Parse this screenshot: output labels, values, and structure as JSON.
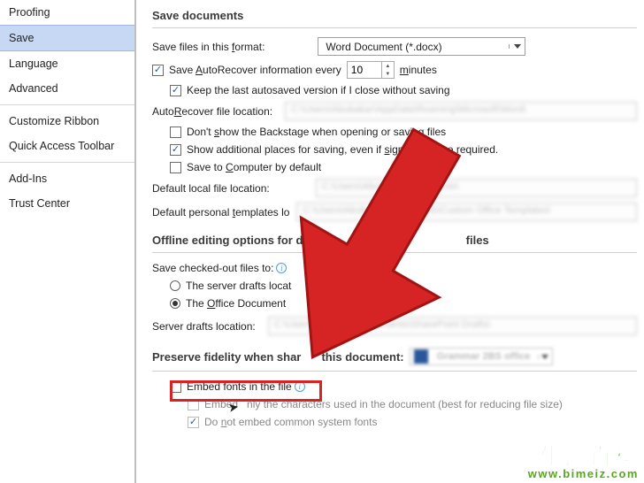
{
  "nav": {
    "items": [
      {
        "label": "Proofing"
      },
      {
        "label": "Save"
      },
      {
        "label": "Language"
      },
      {
        "label": "Advanced"
      },
      {
        "label": "Customize Ribbon"
      },
      {
        "label": "Quick Access Toolbar"
      },
      {
        "label": "Add-Ins"
      },
      {
        "label": "Trust Center"
      }
    ],
    "selected_index": 1
  },
  "save_documents": {
    "title": "Save documents",
    "format_label_pre": "Save files in this ",
    "format_label_u": "f",
    "format_label_post": "ormat:",
    "format_value": "Word Document (*.docx)",
    "autorecover_pre": "Save ",
    "autorecover_u": "A",
    "autorecover_post": "utoRecover information every",
    "autorecover_value": "10",
    "autorecover_unit_u": "m",
    "autorecover_unit_post": "inutes",
    "keep_last_pre": "Keep the last autosaved version if I close without saving",
    "ar_location_pre": "Auto",
    "ar_location_u": "R",
    "ar_location_post": "ecover file location:",
    "ar_location_value": "C:\\Users\\Abubakar\\AppData\\Roaming\\Microsoft\\Word\\",
    "backstage_pre": "Don't ",
    "backstage_u": "s",
    "backstage_post": "how the Backstage when opening or saving files",
    "addl_places_pre": "Show additional places for saving, even if ",
    "addl_places_u": "s",
    "addl_places_post": "ign-in may be required.",
    "save_comp_pre": "Save to ",
    "save_comp_u": "C",
    "save_comp_post": "omputer by default",
    "def_local_pre": "Default local file location:",
    "def_local_value": "C:\\Users\\Abubakar\\Documents\\",
    "def_tmpl_pre": "Default personal ",
    "def_tmpl_u": "t",
    "def_tmpl_post": "emplates lo",
    "def_tmpl_value": "C:\\Users\\Abubakar\\Documents\\Custom Office Templates\\"
  },
  "offline": {
    "title_pre": "Offline editing options for do",
    "title_post": " files",
    "checked_out_pre": "Save checked-out files to:",
    "radio1_pre": "The server drafts locat",
    "radio2_pre": "The ",
    "radio2_u": "O",
    "radio2_post": "ffice Document",
    "server_drafts_pre": "Server drafts location:",
    "server_drafts_value": "C:\\Users\\Abubakar\\Documents\\SharePoint Drafts\\"
  },
  "fidelity": {
    "title_pre": "Preserve fidelity when shar",
    "title_post": " this document:",
    "doc_value": "Grammar 2BS office",
    "embed_pre": "Embed fonts in the file",
    "embed_only_pre": "Embed ",
    "embed_only_post": "nly the characters used in the document (best for reducing file size)",
    "no_common_pre": "Do ",
    "no_common_u": "n",
    "no_common_post": "ot embed common system fonts"
  },
  "watermark": {
    "cn": "生活百科",
    "url": "www.bimeiz.com"
  }
}
